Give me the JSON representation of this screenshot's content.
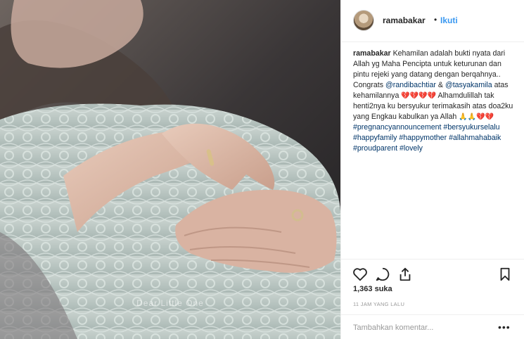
{
  "media": {
    "overlay_text": "Dear Little One"
  },
  "header": {
    "username": "ramabakar",
    "separator": "•",
    "follow_label": "Ikuti"
  },
  "caption": {
    "username": "ramabakar",
    "line1": "Kehamilan adalah bukti nyata dari Allah yg Maha Pencipta untuk keturunan dan pintu rejeki yang datang dengan berqahnya.. Congrats",
    "mention1": "@randibachtiar",
    "amp": "&",
    "mention2": "@tasyakamila",
    "line2": "atas kehamilannya",
    "hearts1": "💔💔💔💔",
    "line3": "Alhamdulillah tak henti2nya ku bersyukur terimakasih atas doa2ku yang Engkau kabulkan ya Allah",
    "emoji2": "🙏🙏💔💔",
    "tags": [
      "#pregnancyannouncement",
      "#bersyukurselalu",
      "#happyfamily",
      "#happymother",
      "#allahmahabaik",
      "#proudparent",
      "#lovely"
    ]
  },
  "actions": {
    "like_icon": "heart-icon",
    "comment_icon": "comment-icon",
    "share_icon": "share-icon",
    "save_icon": "bookmark-icon"
  },
  "likes": "1,363 suka",
  "timestamp": "11 JAM YANG LALU",
  "comment_box": {
    "placeholder": "Tambahkan komentar...",
    "more": "•••"
  },
  "colors": {
    "link": "#003569",
    "follow": "#3897f0",
    "muted": "#999999",
    "border": "#efefef"
  }
}
